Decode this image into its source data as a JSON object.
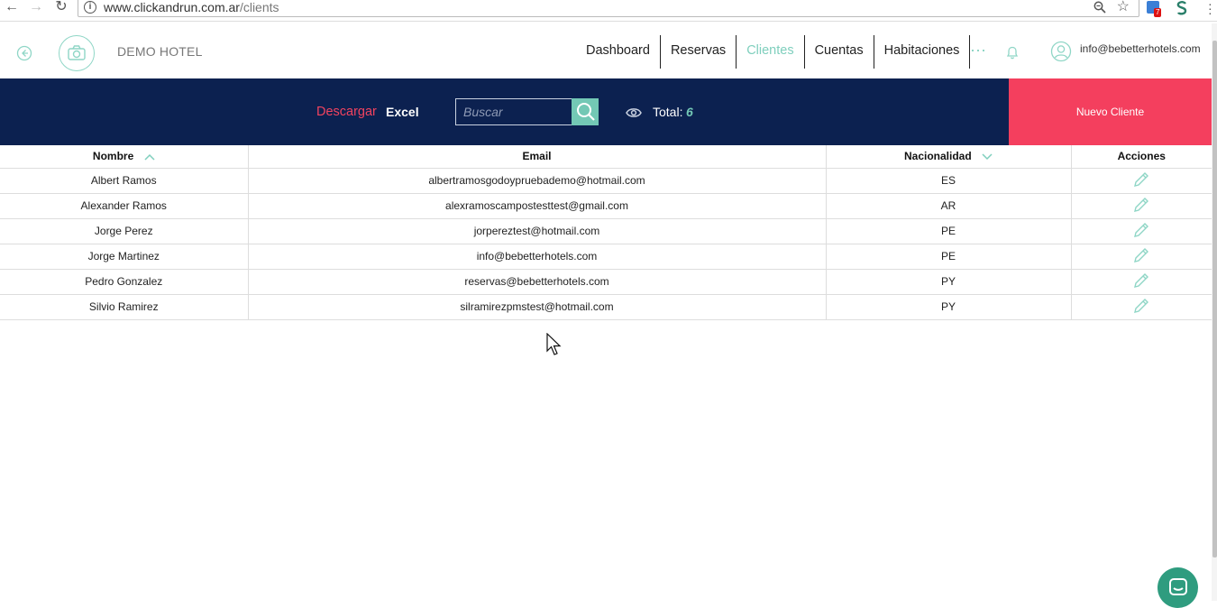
{
  "browser": {
    "url_host": "www.clickandrun.com.ar",
    "url_path": "/clients",
    "extension_badge": "7"
  },
  "header": {
    "hotel_name": "DEMO HOTEL",
    "nav": [
      {
        "label": "Dashboard"
      },
      {
        "label": "Reservas"
      },
      {
        "label": "Clientes",
        "active": true
      },
      {
        "label": "Cuentas"
      },
      {
        "label": "Habitaciones"
      }
    ],
    "user_email": "info@bebetterhotels.com"
  },
  "toolbar": {
    "download_label": "Descargar",
    "excel_label": "Excel",
    "search_placeholder": "Buscar",
    "total_label": "Total:",
    "total_count": "6",
    "new_client_label": "Nuevo Cliente"
  },
  "table": {
    "columns": [
      "Nombre",
      "Email",
      "Nacionalidad",
      "Acciones"
    ],
    "rows": [
      {
        "name": "Albert Ramos",
        "email": "albertramosgodoypruebademo@hotmail.com",
        "nationality": "ES"
      },
      {
        "name": "Alexander Ramos",
        "email": "alexramoscampostesttest@gmail.com",
        "nationality": "AR"
      },
      {
        "name": "Jorge Perez",
        "email": "jorpereztest@hotmail.com",
        "nationality": "PE"
      },
      {
        "name": "Jorge Martinez",
        "email": "info@bebetterhotels.com",
        "nationality": "PE"
      },
      {
        "name": "Pedro Gonzalez",
        "email": "reservas@bebetterhotels.com",
        "nationality": "PY"
      },
      {
        "name": "Silvio Ramirez",
        "email": "silramirezpmstest@hotmail.com",
        "nationality": "PY"
      }
    ]
  },
  "colors": {
    "navy": "#0c2150",
    "accent_teal": "#73c8b5",
    "accent_red": "#f43f5e"
  }
}
